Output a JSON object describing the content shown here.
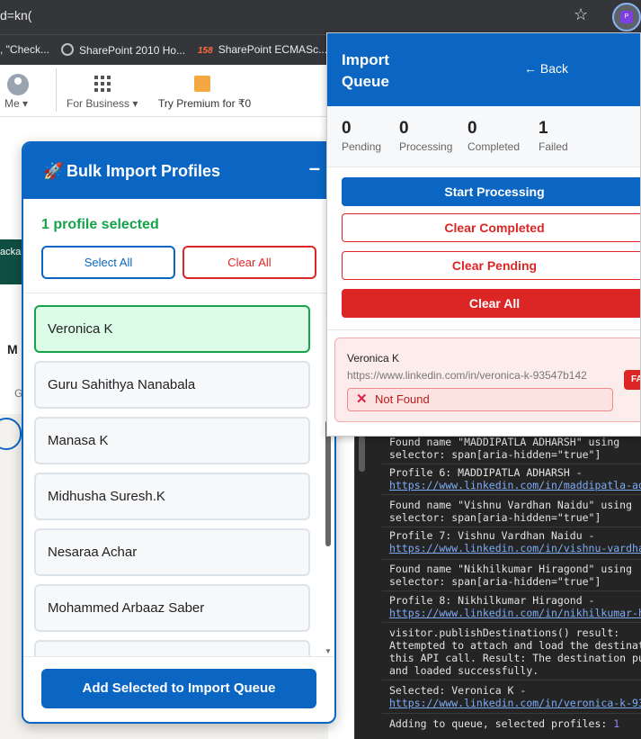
{
  "browser": {
    "address_text": "d=kn(",
    "star_icon": "star-icon",
    "extension_badge": "P",
    "bookmarks": [
      {
        "label": ", \"Check...",
        "icon": ""
      },
      {
        "label": "SharePoint 2010 Ho...",
        "icon": "globe-icon"
      },
      {
        "label": "SharePoint ECMASc...",
        "icon": "158-icon"
      }
    ],
    "bookmark_158": "158"
  },
  "linkedin": {
    "me_label": "Me",
    "business_label": "For Business",
    "premium_label": "Try Premium for ₹0",
    "banner_text": "acka",
    "section_letter": "M",
    "gray_letter": "G"
  },
  "bulk": {
    "title": "Bulk Import Profiles",
    "rocket": "🚀",
    "minimize": "–",
    "selected_text": "1 profile selected",
    "select_all_label": "Select All",
    "clear_all_label": "Clear All",
    "add_label": "Add Selected to Import Queue",
    "profiles": [
      {
        "name": "Veronica K",
        "selected": true
      },
      {
        "name": "Guru Sahithya Nanabala",
        "selected": false
      },
      {
        "name": "Manasa K",
        "selected": false
      },
      {
        "name": "Midhusha Suresh.K",
        "selected": false
      },
      {
        "name": "Nesaraa Achar",
        "selected": false
      },
      {
        "name": "Mohammed Arbaaz Saber",
        "selected": false
      },
      {
        "name": "",
        "selected": false
      }
    ]
  },
  "queue": {
    "title": "Import Queue",
    "back_label": "← Back",
    "stats": [
      {
        "value": "0",
        "label": "Pending"
      },
      {
        "value": "0",
        "label": "Processing"
      },
      {
        "value": "0",
        "label": "Completed"
      },
      {
        "value": "1",
        "label": "Failed"
      }
    ],
    "start_label": "Start Processing",
    "clear_completed_label": "Clear Completed",
    "clear_pending_label": "Clear Pending",
    "clear_all_label": "Clear All",
    "items": [
      {
        "name": "Veronica K",
        "url": "https://www.linkedin.com/in/veronica-k-93547b142",
        "status": "Not Found",
        "badge": "FA"
      }
    ]
  },
  "console": {
    "logs": [
      {
        "text": "Found name \"MADDIPATLA ADHARSH\" using\nselector: span[aria-hidden=\"true\"]",
        "link": ""
      },
      {
        "text": "Profile 6: MADDIPATLA ADHARSH -",
        "link": "https://www.linkedin.com/in/maddipatla-adh"
      },
      {
        "text": "Found name \"Vishnu Vardhan Naidu\" using\nselector: span[aria-hidden=\"true\"]",
        "link": ""
      },
      {
        "text": "Profile 7: Vishnu Vardhan Naidu -",
        "link": "https://www.linkedin.com/in/vishnu-vardhan"
      },
      {
        "text": "Found name \"Nikhilkumar Hiragond\" using\nselector: span[aria-hidden=\"true\"]",
        "link": ""
      },
      {
        "text": "Profile 8: Nikhilkumar Hiragond -",
        "link": "https://www.linkedin.com/in/nikhilkumar-hi"
      },
      {
        "text": "visitor.publishDestinations() result:\nAttempted to attach and load the destinati\nthis API call. Result: The destination pub\nand loaded successfully.",
        "link": ""
      },
      {
        "text": "Selected: Veronica K -",
        "link": "https://www.linkedin.com/in/veronica-k-935"
      },
      {
        "text": "Adding to queue, selected profiles: ",
        "link": "",
        "num": "1"
      }
    ]
  }
}
